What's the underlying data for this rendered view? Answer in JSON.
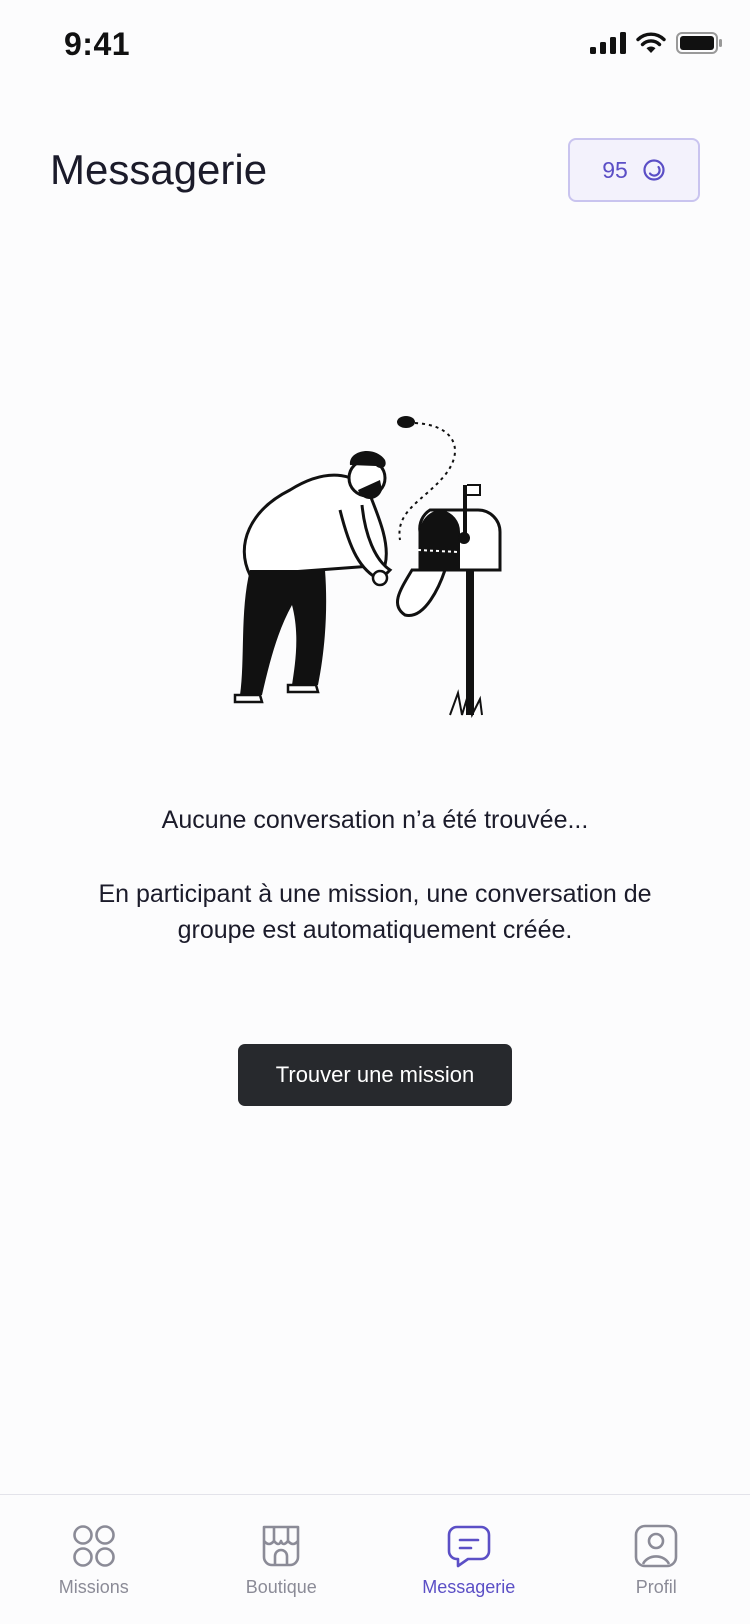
{
  "status_bar": {
    "time": "9:41"
  },
  "header": {
    "title": "Messagerie",
    "credits": "95"
  },
  "empty_state": {
    "title": "Aucune conversation n’a été trouvée...",
    "description": "En participant à une mission, une conversation de groupe est automatiquement créée.",
    "cta_label": "Trouver une mission"
  },
  "tabbar": {
    "items": [
      {
        "label": "Missions",
        "icon": "grid-icon",
        "active": false
      },
      {
        "label": "Boutique",
        "icon": "store-icon",
        "active": false
      },
      {
        "label": "Messagerie",
        "icon": "message-icon",
        "active": true
      },
      {
        "label": "Profil",
        "icon": "profile-icon",
        "active": false
      }
    ]
  },
  "colors": {
    "accent": "#5B4FC6",
    "button": "#27292D",
    "inactive": "#8B8B97"
  }
}
